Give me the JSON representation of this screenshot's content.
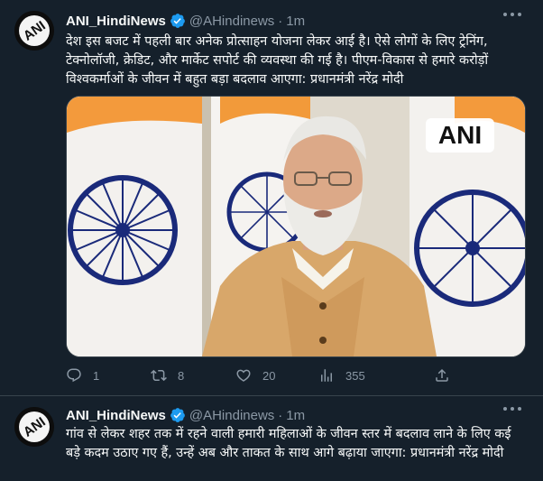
{
  "tweets": [
    {
      "display_name": "ANI_HindiNews",
      "handle": "@AHindinews",
      "separator": "·",
      "time": "1m",
      "avatar_text": "ANI",
      "text": "देश इस बजट में पहली बार अनेक प्रोत्साहन योजना लेकर आई है। ऐसे लोगों के लिए ट्रेनिंग, टेक्नोलॉजी, क्रेडिट, और मार्केट सपोर्ट की व्यवस्था की गई है। पीएम-विकास से हमारे करोड़ों विश्वकर्माओं के जीवन में बहुत बड़ा बदलाव आएगा: प्रधानमंत्री नरेंद्र मोदी",
      "media_watermark": "ANI",
      "actions": {
        "replies": "1",
        "retweets": "8",
        "likes": "20",
        "views": "355"
      }
    },
    {
      "display_name": "ANI_HindiNews",
      "handle": "@AHindinews",
      "separator": "·",
      "time": "1m",
      "avatar_text": "ANI",
      "text": "गांव से लेकर शहर तक में रहने वाली हमारी महिलाओं के जीवन स्तर में बदलाव लाने के लिए कई बड़े कदम उठाए गए हैं, उन्हें अब और ताकत के साथ आगे बढ़ाया जाएगा: प्रधानमंत्री नरेंद्र मोदी"
    }
  ],
  "colors": {
    "background": "#15202b",
    "text": "#f7f9f9",
    "muted": "#8b98a5",
    "verified": "#1d9bf0",
    "divider": "#38444d"
  },
  "icons": [
    "ani-logo-icon",
    "verified-badge-icon",
    "more-icon",
    "reply-icon",
    "retweet-icon",
    "like-icon",
    "views-icon",
    "share-icon"
  ]
}
